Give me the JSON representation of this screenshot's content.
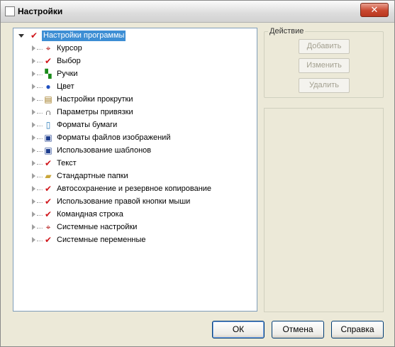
{
  "window": {
    "title": "Настройки",
    "close_glyph": "✕"
  },
  "tree": {
    "root": {
      "label": "Настройки программы",
      "icon": "check-icon"
    },
    "items": [
      {
        "label": "Курсор",
        "icon": "cursor-icon"
      },
      {
        "label": "Выбор",
        "icon": "check-icon"
      },
      {
        "label": "Ручки",
        "icon": "grips-icon"
      },
      {
        "label": "Цвет",
        "icon": "color-icon"
      },
      {
        "label": "Настройки прокрутки",
        "icon": "scroll-icon"
      },
      {
        "label": "Параметры привязки",
        "icon": "magnet-icon"
      },
      {
        "label": "Форматы бумаги",
        "icon": "paper-icon"
      },
      {
        "label": "Форматы файлов изображений",
        "icon": "floppy-icon"
      },
      {
        "label": "Использование шаблонов",
        "icon": "floppy-icon"
      },
      {
        "label": "Текст",
        "icon": "check-icon"
      },
      {
        "label": "Стандартные папки",
        "icon": "folder-icon"
      },
      {
        "label": "Автосохранение и резервное копирование",
        "icon": "check-icon"
      },
      {
        "label": "Использование правой кнопки мыши",
        "icon": "check-icon"
      },
      {
        "label": "Командная строка",
        "icon": "check-icon"
      },
      {
        "label": "Системные настройки",
        "icon": "cursor-icon"
      },
      {
        "label": "Системные переменные",
        "icon": "check-icon"
      }
    ]
  },
  "action_group": {
    "label": "Действие",
    "add": "Добавить",
    "edit": "Изменить",
    "delete": "Удалить"
  },
  "buttons": {
    "ok": "ОК",
    "cancel": "Отмена",
    "help": "Справка"
  },
  "colors": {
    "selection": "#3d8ed4",
    "check": "#d0161b",
    "close": "#c8472f"
  }
}
